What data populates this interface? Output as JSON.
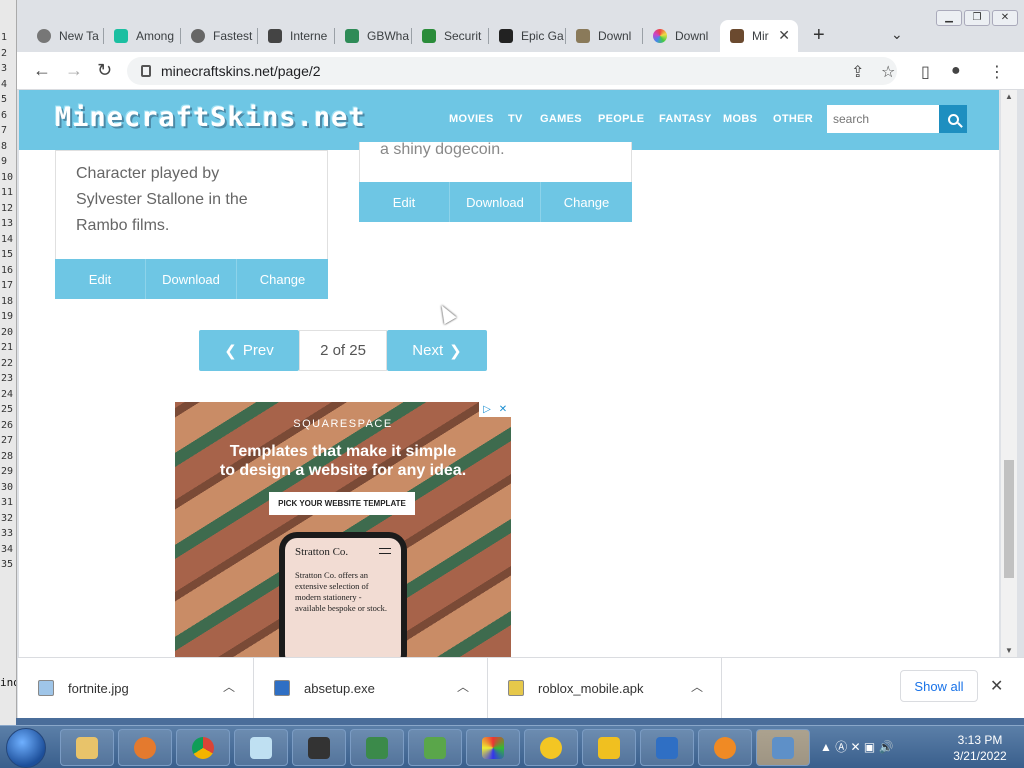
{
  "browser": {
    "tabs": [
      {
        "label": "New Ta",
        "color": "#5f6368"
      },
      {
        "label": "Among",
        "color": "#1bbfa1"
      },
      {
        "label": "Fastest",
        "color": "#5f6368"
      },
      {
        "label": "Interne",
        "color": "#444444"
      },
      {
        "label": "GBWha",
        "color": "#2e8b57"
      },
      {
        "label": "Securit",
        "color": "#2a8c3a"
      },
      {
        "label": "Epic Ga",
        "color": "#222222"
      },
      {
        "label": "Downl",
        "color": "#8a7a5a"
      },
      {
        "label": "Downl",
        "color": "#d64fa0"
      },
      {
        "label": "Mir",
        "color": "#6b4a2f"
      }
    ],
    "url": "minecraftskins.net/page/2",
    "window_controls": [
      "minimize",
      "restore",
      "close"
    ]
  },
  "site": {
    "logo": "MinecraftSkins.net",
    "nav": [
      "MOVIES",
      "TV",
      "GAMES",
      "PEOPLE",
      "FANTASY",
      "MOBS",
      "OTHER"
    ],
    "search_placeholder": "search",
    "cards": [
      {
        "desc_line1": "Character played by",
        "desc_line2": "Sylvester Stallone in the",
        "desc_line3": "Rambo films.",
        "actions": [
          "Edit",
          "Download",
          "Change"
        ]
      },
      {
        "desc_line1": "a shiny dogecoin.",
        "actions": [
          "Edit",
          "Download",
          "Change"
        ]
      }
    ],
    "pager": {
      "prev": "Prev",
      "current": "2 of 25",
      "next": "Next"
    }
  },
  "ad": {
    "brand": "SQUARESPACE",
    "headline_line1": "Templates that make it simple",
    "headline_line2": "to design a website for any idea.",
    "cta": "PICK YOUR WEBSITE TEMPLATE",
    "phone_title": "Stratton Co.",
    "phone_body": "Stratton Co. offers an extensive selection of modern stationery - available bespoke or stock."
  },
  "downloads": [
    {
      "name": "fortnite.jpg"
    },
    {
      "name": "absetup.exe"
    },
    {
      "name": "roblox_mobile.apk"
    }
  ],
  "show_all": "Show all",
  "taskbar": {
    "time": "3:13 PM",
    "date": "3/21/2022"
  },
  "left_strip_numbers": "1\n2\n3\n4\n5\n6\n7\n8\n9\n10\n11\n12\n13\n14\n15\n16\n17\n18\n19\n20\n21\n22\n23\n24\n25\n26\n27\n28\n29\n30\n31\n32\n33\n34\n35",
  "left_strip_label": "ind"
}
